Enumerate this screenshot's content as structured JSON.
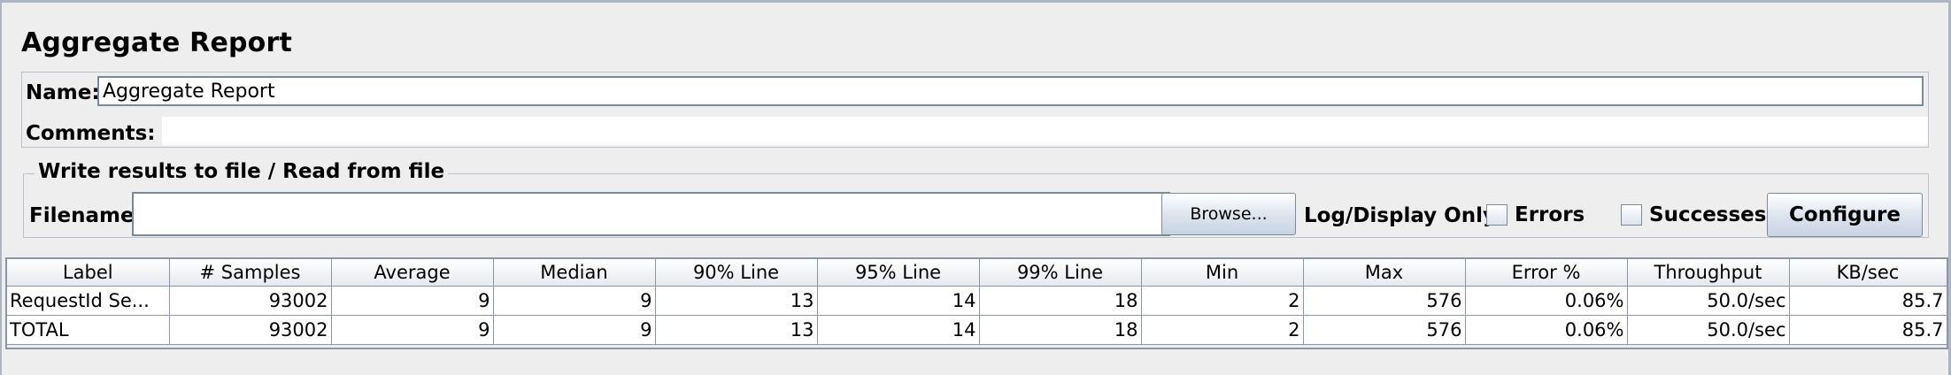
{
  "panel": {
    "title": "Aggregate Report",
    "name_label": "Name:",
    "name_value": "Aggregate Report",
    "comments_label": "Comments:",
    "comments_value": ""
  },
  "file_group": {
    "legend": "Write results to file / Read from file",
    "filename_label": "Filename",
    "filename_value": "",
    "browse_label": "Browse...",
    "log_label": "Log/Display Only:",
    "errors_label": "Errors",
    "errors_checked": false,
    "successes_label": "Successes",
    "successes_checked": false,
    "configure_label": "Configure"
  },
  "table": {
    "columns": [
      "Label",
      "# Samples",
      "Average",
      "Median",
      "90% Line",
      "95% Line",
      "99% Line",
      "Min",
      "Max",
      "Error %",
      "Throughput",
      "KB/sec"
    ],
    "rows": [
      [
        "RequestId Se...",
        "93002",
        "9",
        "9",
        "13",
        "14",
        "18",
        "2",
        "576",
        "0.06%",
        "50.0/sec",
        "85.7"
      ],
      [
        "TOTAL",
        "93002",
        "9",
        "9",
        "13",
        "14",
        "18",
        "2",
        "576",
        "0.06%",
        "50.0/sec",
        "85.7"
      ]
    ]
  },
  "colors": {
    "background": "#eeeeee",
    "border": "#8a96a4",
    "button_gradient_end": "#c8d3e2"
  }
}
